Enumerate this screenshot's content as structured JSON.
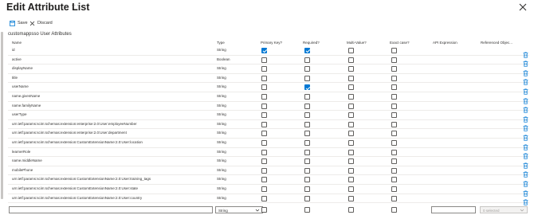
{
  "panel": {
    "title": "Edit Attribute List",
    "more": "···"
  },
  "toolbar": {
    "save_label": "Save",
    "discard_label": "Discard"
  },
  "section": {
    "subtitle": "customappsso User Attributes"
  },
  "columns": {
    "name": "Name",
    "type": "Type",
    "primary_key": "Primary Key?",
    "required": "Required?",
    "multi_value": "Multi-Value?",
    "exact_case": "Exact case?",
    "api_expression": "API Expression",
    "referenced_object": "Referenced Objec..."
  },
  "rows": [
    {
      "name": "id",
      "type": "String",
      "primary": true,
      "required": true,
      "multi": false,
      "exact": false
    },
    {
      "name": "active",
      "type": "Boolean",
      "primary": false,
      "required": false,
      "multi": false,
      "exact": false
    },
    {
      "name": "displayName",
      "type": "String",
      "primary": false,
      "required": false,
      "multi": false,
      "exact": false
    },
    {
      "name": "title",
      "type": "String",
      "primary": false,
      "required": false,
      "multi": false,
      "exact": false
    },
    {
      "name": "userName",
      "type": "String",
      "primary": false,
      "required": true,
      "multi": false,
      "exact": false
    },
    {
      "name": "name.givenName",
      "type": "String",
      "primary": false,
      "required": false,
      "multi": false,
      "exact": false
    },
    {
      "name": "name.familyName",
      "type": "String",
      "primary": false,
      "required": false,
      "multi": false,
      "exact": false
    },
    {
      "name": "userType",
      "type": "String",
      "primary": false,
      "required": false,
      "multi": false,
      "exact": false
    },
    {
      "name": "urn:ietf:params:scim:schemas:extension:enterprise:2.0:User:employeeNumber",
      "type": "String",
      "primary": false,
      "required": false,
      "multi": false,
      "exact": false
    },
    {
      "name": "urn:ietf:params:scim:schemas:extension:enterprise:2.0:User:department",
      "type": "String",
      "primary": false,
      "required": false,
      "multi": false,
      "exact": false
    },
    {
      "name": "urn:ietf:params:scim:schemas:extension:CustomExtensionName:2.0:User:location",
      "type": "String",
      "primary": false,
      "required": false,
      "multi": false,
      "exact": false
    },
    {
      "name": "learnerRole",
      "type": "String",
      "primary": false,
      "required": false,
      "multi": false,
      "exact": false
    },
    {
      "name": "name.middleName",
      "type": "String",
      "primary": false,
      "required": false,
      "multi": false,
      "exact": false
    },
    {
      "name": "mobilePhone",
      "type": "String",
      "primary": false,
      "required": false,
      "multi": false,
      "exact": false
    },
    {
      "name": "urn:ietf:params:scim:schemas:extension:CustomExtensionName:2.0:User:training_tags",
      "type": "String",
      "primary": false,
      "required": false,
      "multi": false,
      "exact": false
    },
    {
      "name": "urn:ietf:params:scim:schemas:extension:CustomExtensionName:2.0:User:state",
      "type": "String",
      "primary": false,
      "required": false,
      "multi": false,
      "exact": false
    },
    {
      "name": "urn:ietf:params:scim:schemas:extension:CustomExtensionName:2.0:User:country",
      "type": "String",
      "primary": false,
      "required": false,
      "multi": false,
      "exact": false
    }
  ],
  "new_row": {
    "type_value": "String",
    "referenced_value": "0 selected"
  },
  "colors": {
    "accent": "#0078d4",
    "border": "#edebe9"
  }
}
